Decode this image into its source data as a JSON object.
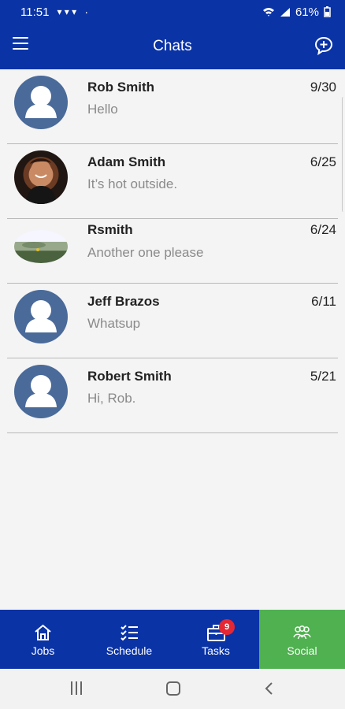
{
  "status_bar": {
    "time": "11:51",
    "notifications": "▾ ▾ ▾",
    "dot": "·",
    "battery": "61%"
  },
  "app_bar": {
    "title": "Chats",
    "menu_icon": "menu-icon",
    "new_chat_icon": "new-chat-icon"
  },
  "chats": [
    {
      "name": "Rob Smith",
      "date": "9/30",
      "preview": "Hello",
      "avatar": "default-user-avatar"
    },
    {
      "name": "Adam Smith",
      "date": "6/25",
      "preview": "It’s hot outside.",
      "avatar": "user-photo-avatar"
    },
    {
      "name": "Rsmith",
      "date": "6/24",
      "preview": "Another one please",
      "avatar": "landscape-avatar"
    },
    {
      "name": "Jeff Brazos",
      "date": "6/11",
      "preview": "Whatsup",
      "avatar": "default-user-avatar"
    },
    {
      "name": "Robert Smith",
      "date": "5/21",
      "preview": "Hi, Rob.",
      "avatar": "default-user-avatar"
    }
  ],
  "bottom_nav": [
    {
      "label": "Jobs",
      "icon": "home-icon",
      "active": false
    },
    {
      "label": "Schedule",
      "icon": "checklist-icon",
      "active": false
    },
    {
      "label": "Tasks",
      "icon": "briefcase-icon",
      "badge": "9",
      "active": false
    },
    {
      "label": "Social",
      "icon": "people-icon",
      "active": true
    }
  ],
  "colors": {
    "primary": "#0a33a6",
    "active": "#4fb150",
    "badge": "#e52734"
  }
}
